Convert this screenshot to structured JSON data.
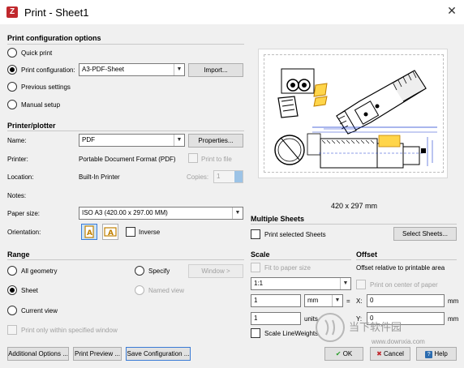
{
  "window": {
    "title": "Print - Sheet1",
    "close_label": "✕"
  },
  "config": {
    "section_title": "Print configuration options",
    "quick_print": "Quick print",
    "print_configuration": "Print configuration:",
    "configuration_value": "A3-PDF-Sheet",
    "import_button": "Import...",
    "previous_settings": "Previous settings",
    "manual_setup": "Manual setup",
    "selected": "print_configuration"
  },
  "printer": {
    "section_title": "Printer/plotter",
    "name_label": "Name:",
    "name_value": "PDF",
    "properties_button": "Properties...",
    "printer_label": "Printer:",
    "printer_value": "Portable Document Format (PDF)",
    "print_to_file": "Print to file",
    "location_label": "Location:",
    "location_value": "Built-In Printer",
    "copies_label": "Copies:",
    "copies_value": "1",
    "notes_label": "Notes:",
    "paper_size_label": "Paper size:",
    "paper_size_value": "ISO A3 (420.00 x 297.00 MM)",
    "orientation_label": "Orientation:",
    "inverse_label": "Inverse"
  },
  "preview": {
    "size_text": "420 x 297 mm"
  },
  "multiple_sheets": {
    "title": "Multiple Sheets",
    "print_selected": "Print selected Sheets",
    "select_sheets_button": "Select Sheets..."
  },
  "range": {
    "section_title": "Range",
    "all_geometry": "All geometry",
    "specify": "Specify",
    "window_button": "Window >",
    "sheet": "Sheet",
    "named_view": "Named view",
    "current_view": "Current view",
    "print_within_window": "Print only within specified window",
    "selected": "sheet"
  },
  "scale": {
    "title": "Scale",
    "fit_to_paper": "Fit to paper size",
    "scale_value": "1:1",
    "mm_value": "1",
    "mm_unit": "mm",
    "equals": "=",
    "units_value": "1",
    "units_label": "units",
    "scale_lineweights": "Scale LineWeights"
  },
  "offset": {
    "title": "Offset",
    "relative_label": "Offset relative to printable area",
    "print_on_center": "Print on center of paper",
    "x_label": "X:",
    "x_value": "0",
    "y_label": "Y:",
    "y_value": "0",
    "unit": "mm"
  },
  "footer": {
    "additional_options": "Additional Options ...",
    "print_preview": "Print Preview ...",
    "save_configuration": "Save Configuration ...",
    "ok": "OK",
    "cancel": "Cancel",
    "help": "Help"
  },
  "watermark": {
    "text": "当下软件园",
    "url": "www.downxia.com"
  },
  "colors": {
    "ok_green": "#2a9d2a",
    "cancel_red": "#c0282d",
    "help_blue": "#2b6cb0",
    "accent": "#3a7bd5"
  }
}
